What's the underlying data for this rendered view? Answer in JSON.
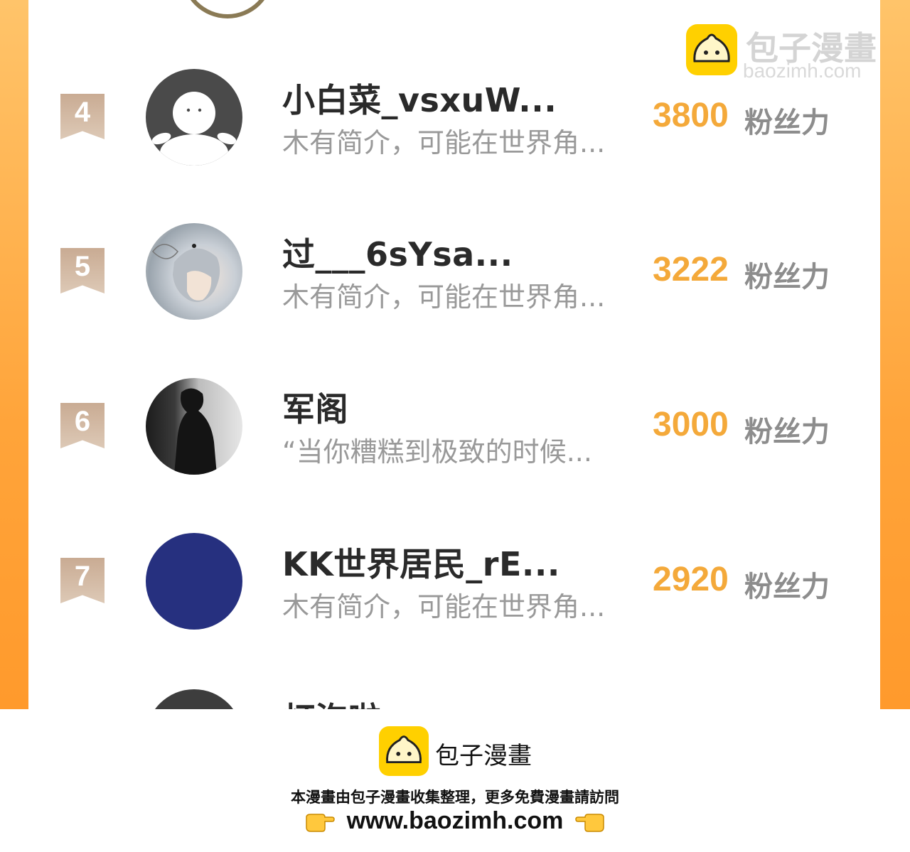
{
  "ranking": [
    {
      "rank": "4",
      "name": "小白菜_vsxuW...",
      "bio": "木有简介，可能在世界角...",
      "fans": "3800",
      "unit": "粉丝力",
      "avatar": "default-user-avatar"
    },
    {
      "rank": "5",
      "name": "过___6sYsa...",
      "bio": "木有简介，可能在世界角...",
      "fans": "3222",
      "unit": "粉丝力",
      "avatar": "anime-boy-avatar"
    },
    {
      "rank": "6",
      "name": "军阁",
      "bio": "“当你糟糕到极致的时候...",
      "fans": "3000",
      "unit": "粉丝力",
      "avatar": "monochrome-photo-avatar"
    },
    {
      "rank": "7",
      "name": "KK世界居民_rE...",
      "bio": "木有简介，可能在世界角...",
      "fans": "2920",
      "unit": "粉丝力",
      "avatar": "navy-solid-avatar"
    },
    {
      "name": "灯泡啦"
    }
  ],
  "watermark": {
    "title": "包子漫畫",
    "url": "baozimh.com"
  },
  "footer": {
    "title": "包子漫畫",
    "notice": "本漫畫由包子漫畫收集整理，更多免費漫畫請訪問",
    "url": "www.baozimh.com"
  },
  "colors": {
    "accent": "#f4a93a",
    "frame": "#ffa43a",
    "rank_badge": "#c9ab93",
    "logo_yellow": "#ffd000"
  }
}
